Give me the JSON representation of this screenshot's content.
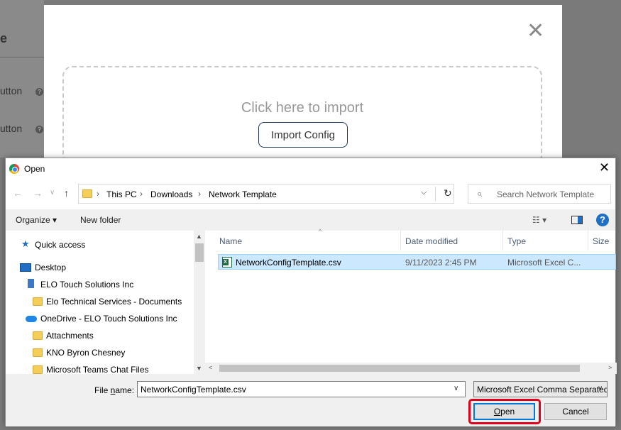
{
  "background": {
    "left_title": "e",
    "left_labels": [
      "utton",
      "utton"
    ],
    "help_glyph": "?",
    "close_glyph": "✕",
    "drop_text": "Click here to import",
    "import_button": "Import Config"
  },
  "dialog": {
    "title": "Open",
    "close_glyph": "✕",
    "address": {
      "back_glyph": "←",
      "forward_glyph": "→",
      "dropdown_glyph": "∨",
      "up_glyph": "↑",
      "sep": "›",
      "crumbs": [
        "This PC",
        "Downloads",
        "Network Template"
      ],
      "dropdown": "⌵",
      "refresh": "↻"
    },
    "search": {
      "placeholder": "Search Network Template",
      "icon_glyph": "⌕"
    },
    "toolbar": {
      "organize": "Organize ▾",
      "new_folder": "New folder",
      "view_glyph": "☷ ▾",
      "help_glyph": "?"
    },
    "nav": {
      "quick_access": "Quick access",
      "desktop": "Desktop",
      "elo": "ELO Touch Solutions Inc",
      "elo_docs": "Elo Technical Services - Documents",
      "onedrive": "OneDrive - ELO Touch Solutions Inc",
      "attachments": "Attachments",
      "kno": "KNO Byron Chesney",
      "teams": "Microsoft Teams Chat Files",
      "scroll_up": "▲",
      "scroll_down": "▼"
    },
    "columns": {
      "name": "Name",
      "date": "Date modified",
      "type": "Type",
      "size": "Size",
      "sort_glyph": "^"
    },
    "files": [
      {
        "name": "NetworkConfigTemplate.csv",
        "date": "9/11/2023 2:45 PM",
        "type": "Microsoft Excel C..."
      }
    ],
    "hscroll": {
      "left": "<",
      "right": ">"
    },
    "bottom": {
      "file_name_label_pre": "File ",
      "file_name_label_u": "n",
      "file_name_label_post": "ame:",
      "file_name_value": "NetworkConfigTemplate.csv",
      "file_type": "Microsoft Excel Comma Separated Values File",
      "dropdown_glyph": "∨",
      "open_u": "O",
      "open_rest": "pen",
      "cancel": "Cancel"
    }
  },
  "colors": {
    "accent": "#0078d7",
    "highlight": "#e0001b",
    "selection": "#cce8ff"
  }
}
